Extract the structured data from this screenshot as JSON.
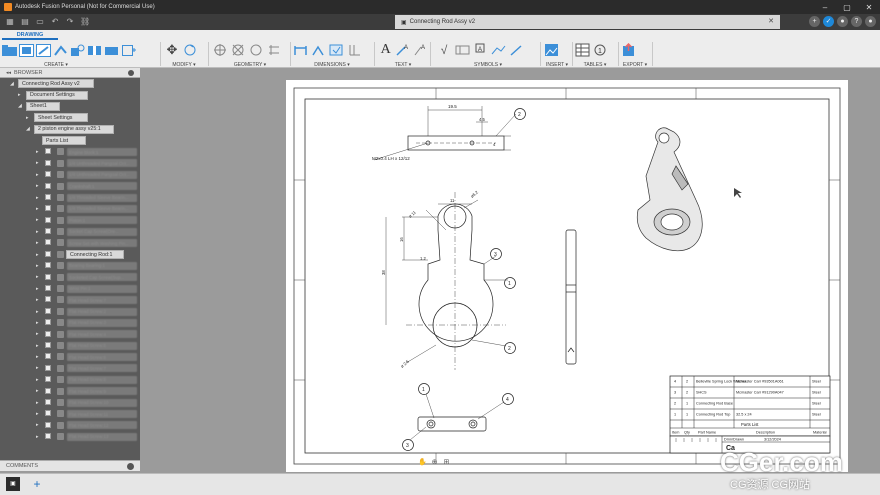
{
  "app": {
    "title": "Autodesk Fusion Personal (Not for Commercial Use)",
    "document_tab": "Connecting Rod Assy v2"
  },
  "ribbon": {
    "active_tab": "DRAWING",
    "groups": [
      {
        "id": "create",
        "label": "CREATE ▾"
      },
      {
        "id": "modify",
        "label": "MODIFY ▾"
      },
      {
        "id": "geometry",
        "label": "GEOMETRY ▾"
      },
      {
        "id": "dimensions",
        "label": "DIMENSIONS ▾"
      },
      {
        "id": "text",
        "label": "TEXT ▾"
      },
      {
        "id": "symbols",
        "label": "SYMBOLS ▾"
      },
      {
        "id": "insert",
        "label": "INSERT ▾"
      },
      {
        "id": "tables",
        "label": "TABLES ▾"
      },
      {
        "id": "export",
        "label": "EXPORT ▾"
      }
    ]
  },
  "browser": {
    "title": "BROWSER",
    "root": "Connecting Rod Assy v2",
    "document_settings": "Document Settings",
    "sheet": "Sheet1",
    "sheet_settings": "Sheet Settings",
    "view": "2 piston engine assy v25:1",
    "parts_list": "Parts List",
    "components": [
      "Engine block:1",
      "1/4 Unthreaded Pangoal Oct...",
      "1/4 Unthreaded Pangoal Oct...",
      "Crankshaft:1",
      "1/4 Threaded Sleeve Bearin...",
      "1/4 Threaded Sleeve Bearin...",
      "Piston:1",
      "Socket Cap Screw(Ore...",
      "Screw Set with Washing Pin...",
      "Connecting Rod:1",
      "Bearing Bearing:1",
      "Socketed Cap Screw(Sup...",
      "Wrist Pin:1",
      "Flat Head Screw:7",
      "Flat Head Screw:2",
      "Flat Head Screw:3",
      "Flat Head Screw:4",
      "Flat Head Screw:5",
      "Flat Head Screw:6",
      "Flat Head Screw:7",
      "Flat Head Screw:8",
      "Flat Head Screw:9",
      "Flat Head Screw:10",
      "Flat Head Screw:11",
      "Flat Head Screw:12",
      "Flat Head Screw:13"
    ],
    "active_component": "Connecting Rod:1",
    "comments": "COMMENTS"
  },
  "drawing": {
    "thread_note": "M2x0.4 LH x 12/12",
    "dims": {
      "top_width": "19.5",
      "slot_depth": "4.5",
      "slot_height": "4",
      "front_width": "11",
      "small_hole": "ø6.2",
      "height_a": "16",
      "height_b": "38",
      "step": "1.2",
      "big_dia": "ø 11",
      "big_dia2": "ø 2.5"
    },
    "balloons": [
      "2",
      "3",
      "1",
      "2",
      "1",
      "4",
      "3"
    ]
  },
  "parts_list": {
    "title": "Parts List",
    "headers": [
      "Item",
      "Qty",
      "Part Name",
      "Description",
      "Material"
    ],
    "rows": [
      [
        "4",
        "2",
        "Belleville Spring Lock Washer",
        "Mcmaster Carr #93501A061",
        "Steel"
      ],
      [
        "3",
        "2",
        "SHCS",
        "Mcmaster Carr #91290A047",
        "Steel"
      ],
      [
        "2",
        "1",
        "Connecting Rod Base",
        "",
        "Steel"
      ],
      [
        "1",
        "1",
        "Connecting Rod Top",
        "32.5 x 24",
        "Steel"
      ]
    ],
    "drawn_label": "Dmn/Drawn",
    "drawn_date": "3/12/2024",
    "sheet_letter": "Ca"
  },
  "watermark": {
    "big": "CGer.com",
    "small": "CG资源 CG网站"
  }
}
